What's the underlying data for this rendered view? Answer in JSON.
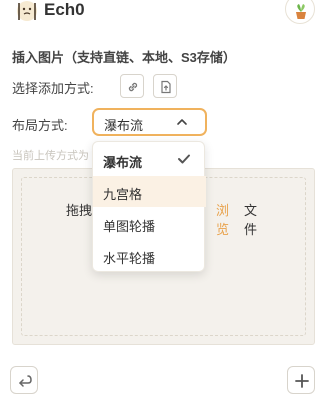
{
  "header": {
    "title": "Ech0",
    "avatar_icon": "kaomoji-avatar-icon",
    "plant_icon": "potted-plant-icon"
  },
  "section_title": "插入图片（支持直链、本地、S3存储）",
  "add_method": {
    "label": "选择添加方式:",
    "icons": [
      "link-icon",
      "upload-file-icon"
    ]
  },
  "layout": {
    "label": "布局方式:",
    "selected": "瀑布流"
  },
  "hint": "当前上传方式为",
  "menu": {
    "items": [
      {
        "label": "瀑布流",
        "checked": true
      },
      {
        "label": "九宫格",
        "hovered": true
      },
      {
        "label": "单图轮播"
      },
      {
        "label": "水平轮播"
      }
    ]
  },
  "drop_zone": {
    "text_prefix": "拖拽文件到此处或",
    "link": "浏览",
    "text_suffix": "文件"
  },
  "bottom": {
    "left_icon": "return-arrow-icon",
    "right_icon": "plus-icon"
  },
  "colors": {
    "accent": "#f0b25d",
    "link": "#e8a24b",
    "drop_bg": "#f4f1ec",
    "hover_bg": "#fbf1e4"
  }
}
